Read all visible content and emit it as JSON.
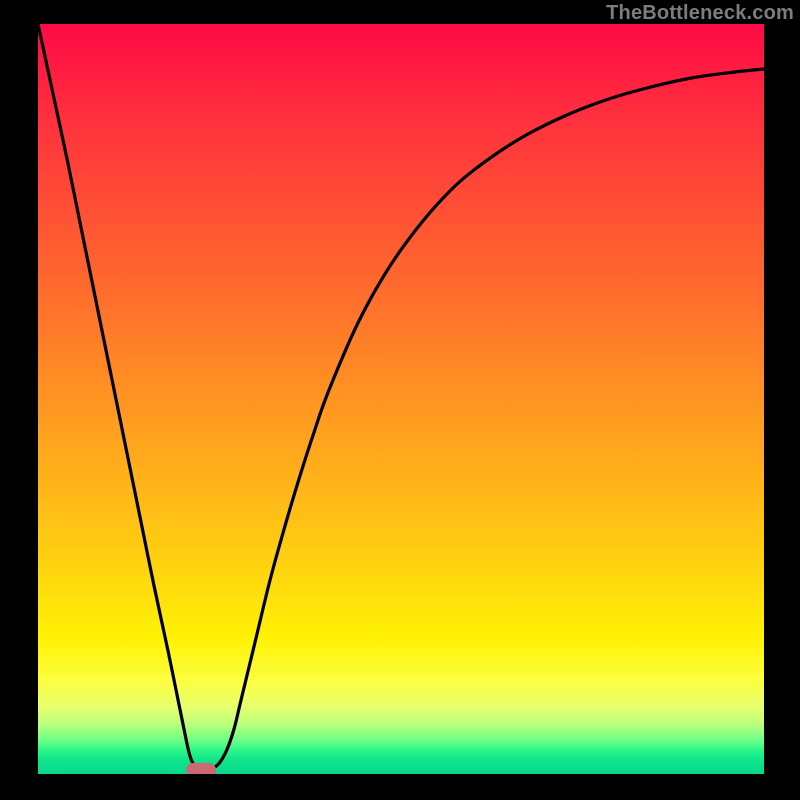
{
  "watermark": "TheBottleneck.com",
  "colors": {
    "frame_bg": "#000000",
    "curve": "#000000",
    "marker": "#cc6a73",
    "watermark": "#7d7d7d"
  },
  "chart_data": {
    "type": "line",
    "title": "",
    "xlabel": "",
    "ylabel": "",
    "xlim": [
      0,
      100
    ],
    "ylim": [
      0,
      100
    ],
    "series": [
      {
        "name": "curve",
        "x": [
          0,
          2,
          4,
          6,
          8,
          10,
          12,
          14,
          16,
          18,
          20,
          21,
          22,
          23,
          24,
          25,
          26,
          27,
          28,
          30,
          32,
          34,
          36,
          38,
          40,
          44,
          48,
          52,
          56,
          60,
          66,
          72,
          78,
          84,
          90,
          96,
          100
        ],
        "y": [
          100,
          91,
          82,
          72.5,
          63,
          53.5,
          44,
          34.5,
          25,
          16,
          6.5,
          2.2,
          0.8,
          0.5,
          0.7,
          1.5,
          3.2,
          6,
          10,
          18,
          26,
          33,
          39.5,
          45.5,
          51,
          60,
          67,
          72.5,
          77,
          80.5,
          84.5,
          87.5,
          89.8,
          91.5,
          92.8,
          93.6,
          94
        ]
      }
    ],
    "marker": {
      "x": 22.5,
      "y": 0.5
    },
    "grid": false,
    "legend": false
  }
}
